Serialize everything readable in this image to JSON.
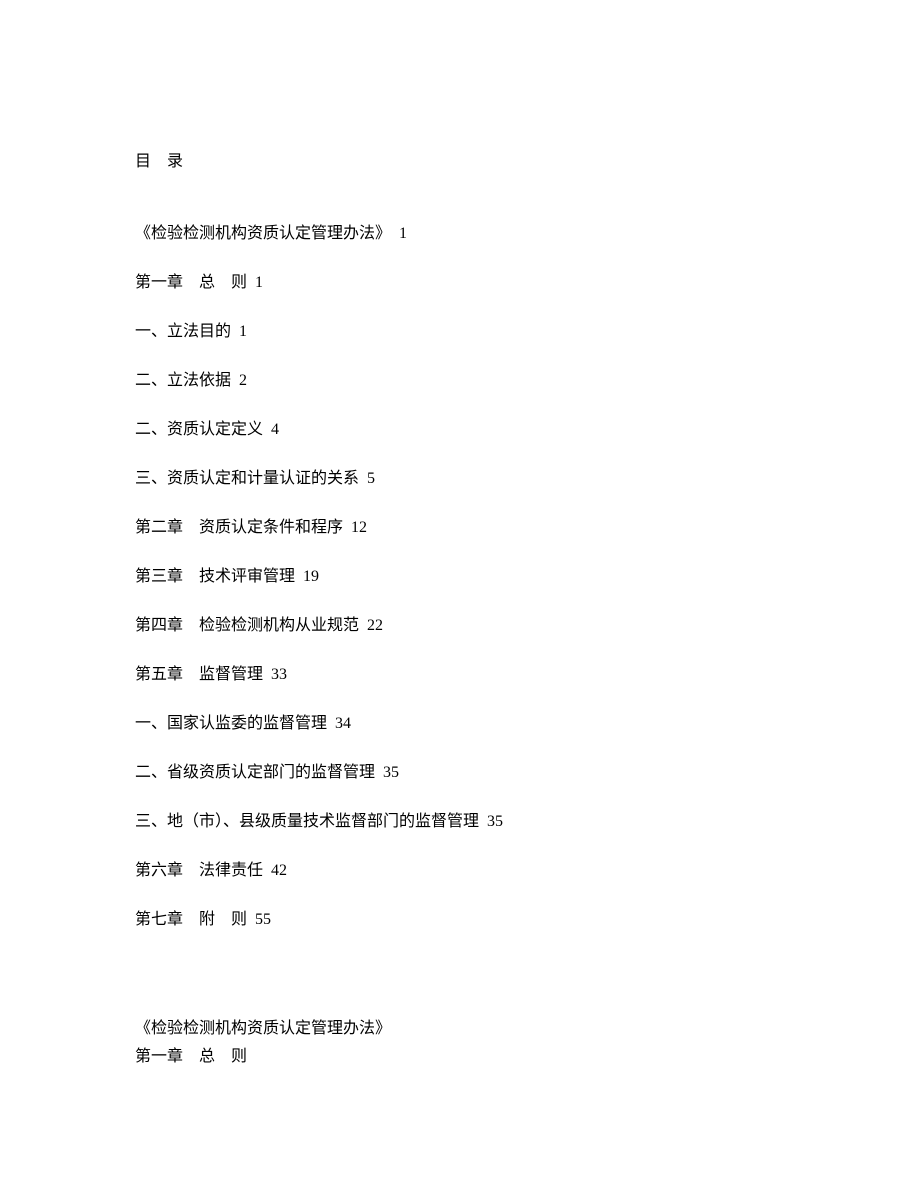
{
  "toc": {
    "title": "目　录",
    "entries": [
      {
        "text": "《检验检测机构资质认定管理办法》",
        "page": "1"
      },
      {
        "text": "第一章　总　则",
        "page": "1"
      },
      {
        "text": "一、立法目的",
        "page": "1"
      },
      {
        "text": "二、立法依据",
        "page": "2"
      },
      {
        "text": "二、资质认定定义",
        "page": "4"
      },
      {
        "text": "三、资质认定和计量认证的关系",
        "page": "5"
      },
      {
        "text": "第二章　资质认定条件和程序",
        "page": "12"
      },
      {
        "text": "第三章　技术评审管理",
        "page": "19"
      },
      {
        "text": "第四章　检验检测机构从业规范",
        "page": "22"
      },
      {
        "text": "第五章　监督管理",
        "page": "33"
      },
      {
        "text": "一、国家认监委的监督管理",
        "page": "34"
      },
      {
        "text": "二、省级资质认定部门的监督管理",
        "page": "35"
      },
      {
        "text": "三、地（市）、县级质量技术监督部门的监督管理",
        "page": "35"
      },
      {
        "text": "第六章　法律责任",
        "page": "42"
      },
      {
        "text": "第七章　附　则",
        "page": "55"
      }
    ]
  },
  "body": {
    "heading1": "《检验检测机构资质认定管理办法》",
    "heading2": "第一章　总　则"
  }
}
